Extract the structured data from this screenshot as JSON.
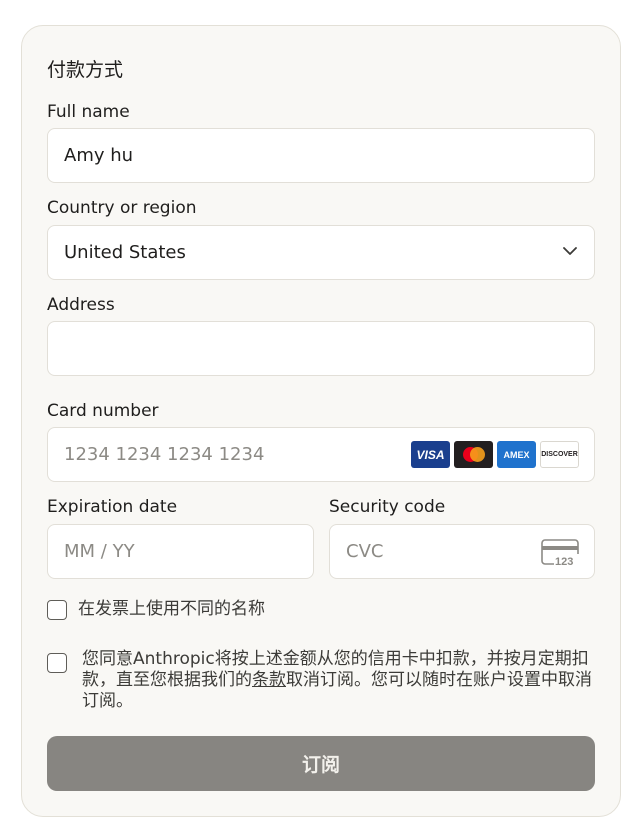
{
  "form": {
    "title": "付款方式",
    "full_name_label": "Full name",
    "full_name_value": "Amy hu",
    "country_label": "Country or region",
    "country_value": "United States",
    "address_label": "Address",
    "address_value": "",
    "card_label": "Card number",
    "card_placeholder": "1234 1234 1234 1234",
    "card_brands": [
      "VISA",
      "AMEX",
      "DISCOVER"
    ],
    "expiry_label": "Expiration date",
    "expiry_placeholder": "MM / YY",
    "security_label": "Security code",
    "security_placeholder": "CVC",
    "cvc_icon_text": "123",
    "different_name_label": "在发票上使用不同的名称",
    "consent_part1": "您同意Anthropic将按上述金额从您的信用卡中扣款，并按月定期扣款，直至您根据我们的",
    "consent_link": "条款",
    "consent_part2": "取消订阅。您可以随时在账户设置中取消订阅。",
    "submit_label": "订阅"
  },
  "colors": {
    "card_bg": "#f9f8f5",
    "submit_bg": "#878581",
    "visa": "#1a3f8e",
    "amex": "#1f72cd"
  },
  "icons": [
    "chevron-down-icon",
    "visa-icon",
    "mastercard-icon",
    "amex-icon",
    "discover-icon",
    "cvc-card-icon"
  ]
}
